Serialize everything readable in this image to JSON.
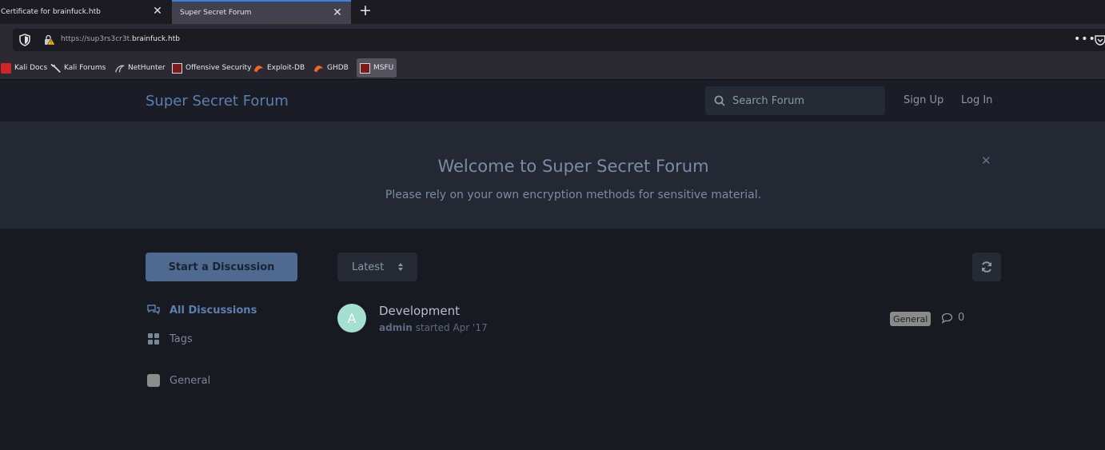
{
  "browser": {
    "tabs": [
      {
        "title": "Certificate for brainfuck.htb",
        "active": false
      },
      {
        "title": "Super Secret Forum",
        "active": true
      }
    ],
    "url": {
      "prefix": "https://sup3rs3cr3t.",
      "domain": "brainfuck.htb"
    },
    "bookmarks": [
      {
        "label": "Kali Docs",
        "icon": "kali-docs-icon"
      },
      {
        "label": "Kali Forums",
        "icon": "kali-dragon-icon"
      },
      {
        "label": "NetHunter",
        "icon": "nethunter-icon"
      },
      {
        "label": "Offensive Security",
        "icon": "offsec-icon"
      },
      {
        "label": "Exploit-DB",
        "icon": "exploit-db-icon"
      },
      {
        "label": "GHDB",
        "icon": "ghdb-icon"
      },
      {
        "label": "MSFU",
        "icon": "msfu-icon"
      }
    ]
  },
  "forum": {
    "title": "Super Secret Forum",
    "search_placeholder": "Search Forum",
    "signup": "Sign Up",
    "login": "Log In",
    "hero": {
      "title": "Welcome to Super Secret Forum",
      "subtitle": "Please rely on your own encryption methods for sensitive material."
    },
    "start_discussion": "Start a Discussion",
    "nav": {
      "all": "All Discussions",
      "tags": "Tags",
      "general": "General"
    },
    "sort": "Latest",
    "discussions": [
      {
        "avatar_letter": "A",
        "title": "Development",
        "author": "admin",
        "started": "started Apr '17",
        "tag": "General",
        "comments": "0"
      }
    ]
  },
  "colors": {
    "accent": "#5d7fad",
    "avatar": "#a3e0cf",
    "tag_general": "#8a8a8a"
  }
}
